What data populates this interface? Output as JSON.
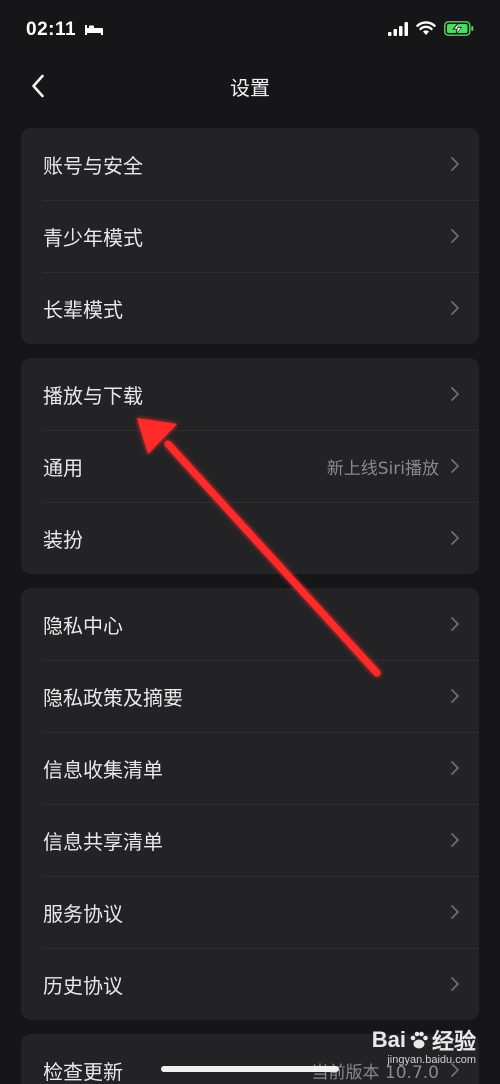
{
  "status_bar": {
    "time": "02:11"
  },
  "nav": {
    "title": "设置"
  },
  "groups": [
    {
      "items": [
        {
          "label": "账号与安全"
        },
        {
          "label": "青少年模式"
        },
        {
          "label": "长辈模式"
        }
      ]
    },
    {
      "items": [
        {
          "label": "播放与下载"
        },
        {
          "label": "通用",
          "value": "新上线Siri播放"
        },
        {
          "label": "装扮"
        }
      ]
    },
    {
      "items": [
        {
          "label": "隐私中心"
        },
        {
          "label": "隐私政策及摘要"
        },
        {
          "label": "信息收集清单"
        },
        {
          "label": "信息共享清单"
        },
        {
          "label": "服务协议"
        },
        {
          "label": "历史协议"
        }
      ]
    },
    {
      "items": [
        {
          "label": "检查更新",
          "value": "当前版本 10.7.0"
        }
      ]
    }
  ],
  "annotation": {
    "color": "#ff2a2a"
  },
  "watermark": {
    "brand_a": "Bai",
    "brand_b": "经验",
    "url": "jingyan.baidu.com"
  },
  "colors": {
    "background": "#161618",
    "card": "#232325",
    "text": "#e9e9e9",
    "secondary": "#8a8a8e",
    "battery": "#4cd964"
  }
}
